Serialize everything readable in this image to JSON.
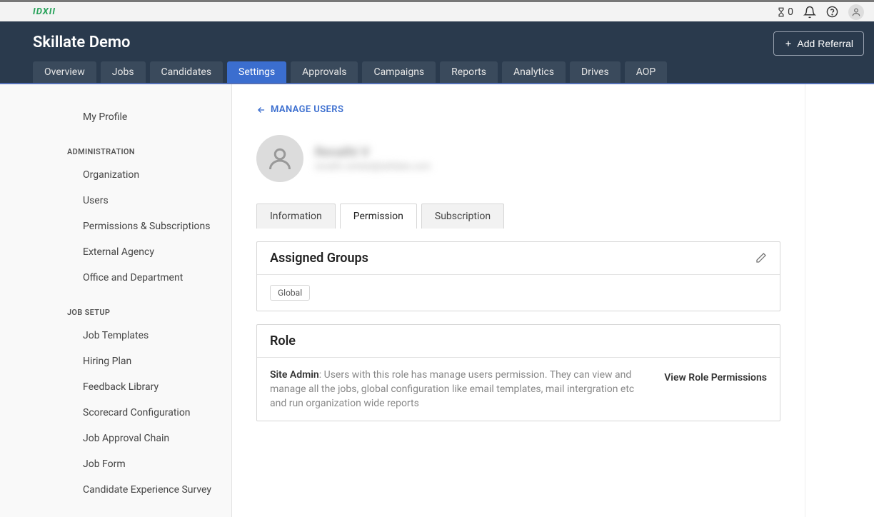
{
  "brandbar": {
    "logo": "IDXII",
    "notif_count": "0"
  },
  "header": {
    "title": "Skillate Demo",
    "add_referral_label": "Add Referral",
    "nav": [
      "Overview",
      "Jobs",
      "Candidates",
      "Settings",
      "Approvals",
      "Campaigns",
      "Reports",
      "Analytics",
      "Drives",
      "AOP"
    ],
    "nav_active_index": 3
  },
  "sidebar": {
    "top_item": "My Profile",
    "sections": [
      {
        "heading": "ADMINISTRATION",
        "items": [
          "Organization",
          "Users",
          "Permissions & Subscriptions",
          "External Agency",
          "Office and Department"
        ]
      },
      {
        "heading": "JOB SETUP",
        "items": [
          "Job Templates",
          "Hiring Plan",
          "Feedback Library",
          "Scorecard Configuration",
          "Job Approval Chain",
          "Job Form",
          "Candidate Experience Survey"
        ]
      }
    ]
  },
  "content": {
    "back_link": "MANAGE USERS",
    "user_name": "Revathi V",
    "user_email": "revathi.venkat@skillate.com",
    "sub_tabs": [
      "Information",
      "Permission",
      "Subscription"
    ],
    "sub_tab_active_index": 1,
    "assigned_groups": {
      "title": "Assigned Groups",
      "tags": [
        "Global"
      ]
    },
    "role": {
      "title": "Role",
      "name": "Site Admin",
      "description": ": Users with this role has manage users permission. They can view and manage all the jobs, global configuration like email templates, mail intergration etc and run organization wide reports",
      "view_link": "View Role Permissions"
    }
  }
}
